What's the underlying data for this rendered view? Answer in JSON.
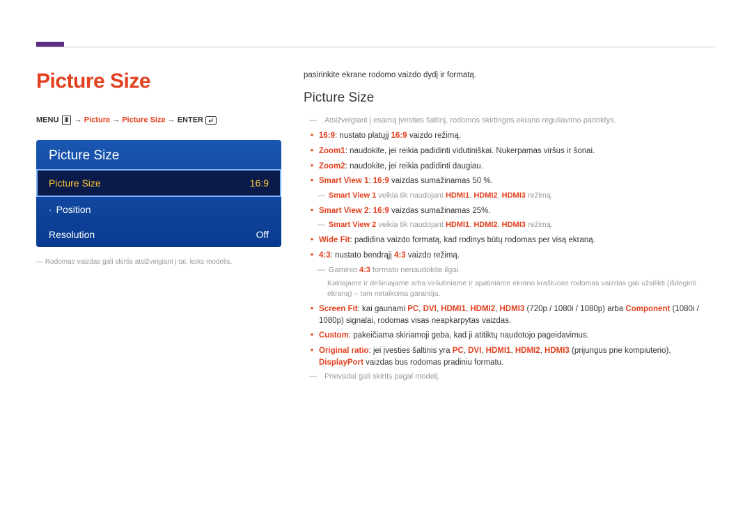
{
  "title": "Picture Size",
  "breadcrumb": {
    "menu": "MENU",
    "arrow": "→",
    "p1": "Picture",
    "p2": "Picture Size",
    "enter": "ENTER"
  },
  "osd": {
    "header": "Picture Size",
    "row1_label": "Picture Size",
    "row1_value": "16:9",
    "row2_label": "Position",
    "row3_label": "Resolution",
    "row3_value": "Off"
  },
  "left_note": "Rodomas vaizdas gali skirtis atsižvelgiant į tai, koks modelis.",
  "right": {
    "intro": "pasirinkite ekrane rodomo vaizdo dydį ir formatą.",
    "section_title": "Picture Size",
    "note_top": "Atsižvelgiant į esamą įvesties šaltinį, rodomos skirtingos ekrano reguliavimo parinktys.",
    "items": {
      "i1a": "16:9",
      "i1b": ": nustato platųjį ",
      "i1c": "16:9",
      "i1d": " vaizdo režimą.",
      "i2a": "Zoom1",
      "i2b": ": naudokite, jei reikia padidinti vidutiniškai. Nukerpamas viršus ir šonai.",
      "i3a": "Zoom2",
      "i3b": ": naudokite, jei reikia padidinti daugiau.",
      "i4a": "Smart View 1",
      "i4b": ": ",
      "i4c": "16:9",
      "i4d": " vaizdas sumažinamas 50 %.",
      "i4n1": "Smart View 1",
      "i4n2": " veikia tik naudojant ",
      "i4n3": "HDMI1",
      "i4n4": ", ",
      "i4n5": "HDMI2",
      "i4n6": ", ",
      "i4n7": "HDMI3",
      "i4n8": " režimą.",
      "i5a": "Smart View 2",
      "i5b": ": ",
      "i5c": "16:9",
      "i5d": " vaizdas sumažinamas 25%.",
      "i5n1": "Smart View 2",
      "i5n2": " veikia tik naudojant ",
      "i5n3": "HDMI1",
      "i5n4": ", ",
      "i5n5": "HDMI2",
      "i5n6": ", ",
      "i5n7": "HDMI3",
      "i5n8": " režimą.",
      "i6a": "Wide Fit",
      "i6b": ": padidina vaizdo formatą, kad rodinys būtų rodomas per visą ekraną.",
      "i7a": "4:3",
      "i7b": ": nustato bendrąjį ",
      "i7c": "4:3",
      "i7d": " vaizdo režimą.",
      "i7n1": "Gaminio ",
      "i7n2": "4:3",
      "i7n3": " formato nenaudokite ilgai.",
      "i7sub": "Kairiajame ir dešiniajame arba viršutiniame ir apatiniame ekrano kraštuose rodomas vaizdas gali užsilikti (išdeginti ekraną) – tam netaikoma garantija.",
      "i8a": "Screen Fit",
      "i8b": ": kai gaunami ",
      "i8c": "PC",
      "i8d": ", ",
      "i8e": "DVI",
      "i8f": ", ",
      "i8g": "HDMI1",
      "i8h": ", ",
      "i8i": "HDMI2",
      "i8j": ", ",
      "i8k": "HDMI3",
      "i8l": " (720p / 1080i / 1080p) arba ",
      "i8m": "Component",
      "i8n": " (1080i / 1080p) signalai, rodomas visas neapkarpytas vaizdas.",
      "i9a": "Custom",
      "i9b": ": pakeičiama skiriamoji geba, kad ji atitiktų naudotojo pageidavimus.",
      "i10a": "Original ratio",
      "i10b": ": jei įvesties šaltinis yra ",
      "i10c": "PC",
      "i10d": ", ",
      "i10e": "DVI",
      "i10f": ", ",
      "i10g": "HDMI1",
      "i10h": ", ",
      "i10i": "HDMI2",
      "i10j": ", ",
      "i10k": "HDMI3",
      "i10l": " (prijungus prie kompiuterio), ",
      "i10m": "DisplayPort",
      "i10n": " vaizdas bus rodomas pradiniu formatu.",
      "note_bottom": "Prievadai gali skirtis pagal modelį."
    }
  }
}
